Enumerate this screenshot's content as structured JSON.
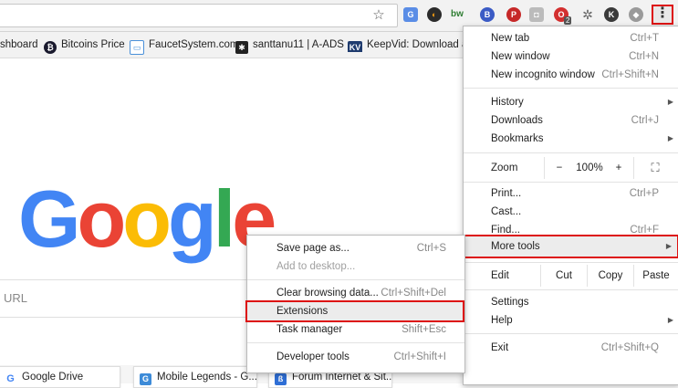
{
  "toolbar": {
    "extensions_badge": "2",
    "colors": {
      "menu_highlight": "#dd1111"
    }
  },
  "bookmarks": [
    {
      "label": "shboard",
      "icon": "none"
    },
    {
      "label": "Bitcoins Price",
      "icon": "bitcoin-icon"
    },
    {
      "label": "FaucetSystem.com",
      "icon": "page-icon"
    },
    {
      "label": "santtanu11 | A-ADS",
      "icon": "ads-icon"
    },
    {
      "label": "KeepVid: Download a",
      "icon": "kv-icon"
    }
  ],
  "page": {
    "logo_letters": [
      "G",
      "o",
      "o",
      "g",
      "l",
      "e"
    ],
    "logo_colors": [
      "#4285f4",
      "#ea4335",
      "#fbbc05",
      "#4285f4",
      "#34a853",
      "#ea4335"
    ],
    "search_placeholder": "URL"
  },
  "tiles": [
    {
      "label": "Google Drive",
      "icon": "google-drive-icon"
    },
    {
      "label": "Mobile Legends - G...",
      "icon": "g-tile-icon"
    },
    {
      "label": "Forum Internet & Sit...",
      "icon": "forum-icon"
    }
  ],
  "menu": {
    "new_tab": {
      "label": "New tab",
      "shortcut": "Ctrl+T"
    },
    "new_window": {
      "label": "New window",
      "shortcut": "Ctrl+N"
    },
    "new_incognito": {
      "label": "New incognito window",
      "shortcut": "Ctrl+Shift+N"
    },
    "history": {
      "label": "History"
    },
    "downloads": {
      "label": "Downloads",
      "shortcut": "Ctrl+J"
    },
    "bookmarks": {
      "label": "Bookmarks"
    },
    "zoom": {
      "label": "Zoom",
      "minus": "−",
      "value": "100%",
      "plus": "+"
    },
    "print": {
      "label": "Print...",
      "shortcut": "Ctrl+P"
    },
    "cast": {
      "label": "Cast..."
    },
    "find": {
      "label": "Find...",
      "shortcut": "Ctrl+F"
    },
    "more_tools": {
      "label": "More tools"
    },
    "edit": {
      "label": "Edit",
      "cut": "Cut",
      "copy": "Copy",
      "paste": "Paste"
    },
    "settings": {
      "label": "Settings"
    },
    "help": {
      "label": "Help"
    },
    "exit": {
      "label": "Exit",
      "shortcut": "Ctrl+Shift+Q"
    }
  },
  "submenu": {
    "save_page": {
      "label": "Save page as...",
      "shortcut": "Ctrl+S"
    },
    "add_desktop": {
      "label": "Add to desktop..."
    },
    "clear_browsing": {
      "label": "Clear browsing data...",
      "shortcut": "Ctrl+Shift+Del"
    },
    "extensions": {
      "label": "Extensions"
    },
    "task_manager": {
      "label": "Task manager",
      "shortcut": "Shift+Esc"
    },
    "dev_tools": {
      "label": "Developer tools",
      "shortcut": "Ctrl+Shift+I"
    }
  }
}
